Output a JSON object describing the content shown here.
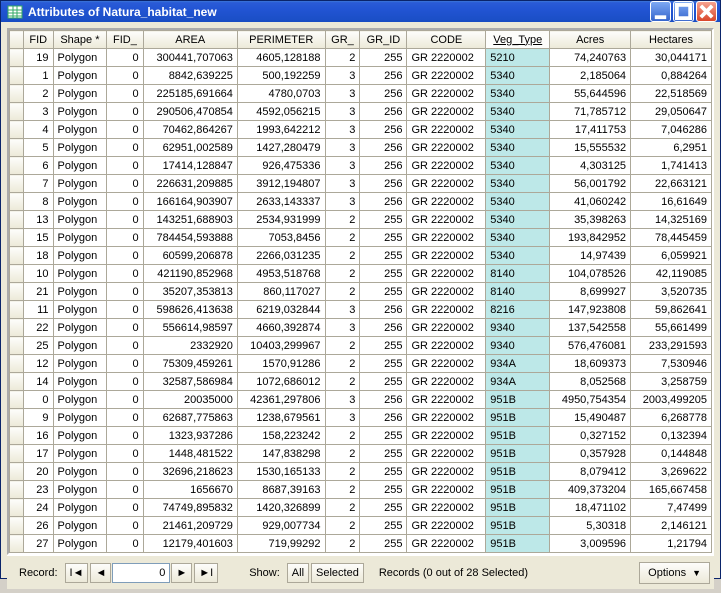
{
  "window": {
    "title": "Attributes of Natura_habitat_new"
  },
  "columns": [
    "FID",
    "Shape *",
    "FID_",
    "AREA",
    "PERIMETER",
    "GR_",
    "GR_ID",
    "CODE",
    "Veg_Type",
    "Acres",
    "Hectares"
  ],
  "column_types": [
    "num",
    "text",
    "num",
    "text",
    "text",
    "num",
    "num",
    "text",
    "text",
    "text",
    "text"
  ],
  "sorted_column": "Veg_Type",
  "rows": [
    [
      19,
      "Polygon",
      0,
      "300441,707063",
      "4605,128188",
      2,
      255,
      "GR 2220002",
      "5210",
      "74,240763",
      "30,044171"
    ],
    [
      1,
      "Polygon",
      0,
      "8842,639225",
      "500,192259",
      3,
      256,
      "GR 2220002",
      "5340",
      "2,185064",
      "0,884264"
    ],
    [
      2,
      "Polygon",
      0,
      "225185,691664",
      "4780,0703",
      3,
      256,
      "GR 2220002",
      "5340",
      "55,644596",
      "22,518569"
    ],
    [
      3,
      "Polygon",
      0,
      "290506,470854",
      "4592,056215",
      3,
      256,
      "GR 2220002",
      "5340",
      "71,785712",
      "29,050647"
    ],
    [
      4,
      "Polygon",
      0,
      "70462,864267",
      "1993,642212",
      3,
      256,
      "GR 2220002",
      "5340",
      "17,411753",
      "7,046286"
    ],
    [
      5,
      "Polygon",
      0,
      "62951,002589",
      "1427,280479",
      3,
      256,
      "GR 2220002",
      "5340",
      "15,555532",
      "6,2951"
    ],
    [
      6,
      "Polygon",
      0,
      "17414,128847",
      "926,475336",
      3,
      256,
      "GR 2220002",
      "5340",
      "4,303125",
      "1,741413"
    ],
    [
      7,
      "Polygon",
      0,
      "226631,209885",
      "3912,194807",
      3,
      256,
      "GR 2220002",
      "5340",
      "56,001792",
      "22,663121"
    ],
    [
      8,
      "Polygon",
      0,
      "166164,903907",
      "2633,143337",
      3,
      256,
      "GR 2220002",
      "5340",
      "41,060242",
      "16,61649"
    ],
    [
      13,
      "Polygon",
      0,
      "143251,688903",
      "2534,931999",
      2,
      255,
      "GR 2220002",
      "5340",
      "35,398263",
      "14,325169"
    ],
    [
      15,
      "Polygon",
      0,
      "784454,593888",
      "7053,8456",
      2,
      255,
      "GR 2220002",
      "5340",
      "193,842952",
      "78,445459"
    ],
    [
      18,
      "Polygon",
      0,
      "60599,206878",
      "2266,031235",
      2,
      255,
      "GR 2220002",
      "5340",
      "14,97439",
      "6,059921"
    ],
    [
      10,
      "Polygon",
      0,
      "421190,852968",
      "4953,518768",
      2,
      255,
      "GR 2220002",
      "8140",
      "104,078526",
      "42,119085"
    ],
    [
      21,
      "Polygon",
      0,
      "35207,353813",
      "860,117027",
      2,
      255,
      "GR 2220002",
      "8140",
      "8,699927",
      "3,520735"
    ],
    [
      11,
      "Polygon",
      0,
      "598626,413638",
      "6219,032844",
      3,
      256,
      "GR 2220002",
      "8216",
      "147,923808",
      "59,862641"
    ],
    [
      22,
      "Polygon",
      0,
      "556614,98597",
      "4660,392874",
      3,
      256,
      "GR 2220002",
      "9340",
      "137,542558",
      "55,661499"
    ],
    [
      25,
      "Polygon",
      0,
      "2332920",
      "10403,299967",
      2,
      255,
      "GR 2220002",
      "9340",
      "576,476081",
      "233,291593"
    ],
    [
      12,
      "Polygon",
      0,
      "75309,459261",
      "1570,91286",
      2,
      255,
      "GR 2220002",
      "934A",
      "18,609373",
      "7,530946"
    ],
    [
      14,
      "Polygon",
      0,
      "32587,586984",
      "1072,686012",
      2,
      255,
      "GR 2220002",
      "934A",
      "8,052568",
      "3,258759"
    ],
    [
      0,
      "Polygon",
      0,
      "20035000",
      "42361,297806",
      3,
      256,
      "GR 2220002",
      "951B",
      "4950,754354",
      "2003,499205"
    ],
    [
      9,
      "Polygon",
      0,
      "62687,775863",
      "1238,679561",
      3,
      256,
      "GR 2220002",
      "951B",
      "15,490487",
      "6,268778"
    ],
    [
      16,
      "Polygon",
      0,
      "1323,937286",
      "158,223242",
      2,
      255,
      "GR 2220002",
      "951B",
      "0,327152",
      "0,132394"
    ],
    [
      17,
      "Polygon",
      0,
      "1448,481522",
      "147,838298",
      2,
      255,
      "GR 2220002",
      "951B",
      "0,357928",
      "0,144848"
    ],
    [
      20,
      "Polygon",
      0,
      "32696,218623",
      "1530,165133",
      2,
      255,
      "GR 2220002",
      "951B",
      "8,079412",
      "3,269622"
    ],
    [
      23,
      "Polygon",
      0,
      "1656670",
      "8687,39163",
      2,
      255,
      "GR 2220002",
      "951B",
      "409,373204",
      "165,667458"
    ],
    [
      24,
      "Polygon",
      0,
      "74749,895832",
      "1420,326899",
      2,
      255,
      "GR 2220002",
      "951B",
      "18,471102",
      "7,47499"
    ],
    [
      26,
      "Polygon",
      0,
      "21461,209729",
      "929,007734",
      2,
      255,
      "GR 2220002",
      "951B",
      "5,30318",
      "2,146121"
    ],
    [
      27,
      "Polygon",
      0,
      "12179,401603",
      "719,99292",
      2,
      255,
      "GR 2220002",
      "951B",
      "3,009596",
      "1,21794"
    ]
  ],
  "footer": {
    "record_label": "Record:",
    "record_value": "0",
    "show_label": "Show:",
    "btn_all": "All",
    "btn_selected": "Selected",
    "status": "Records (0 out of 28 Selected)",
    "options": "Options"
  }
}
